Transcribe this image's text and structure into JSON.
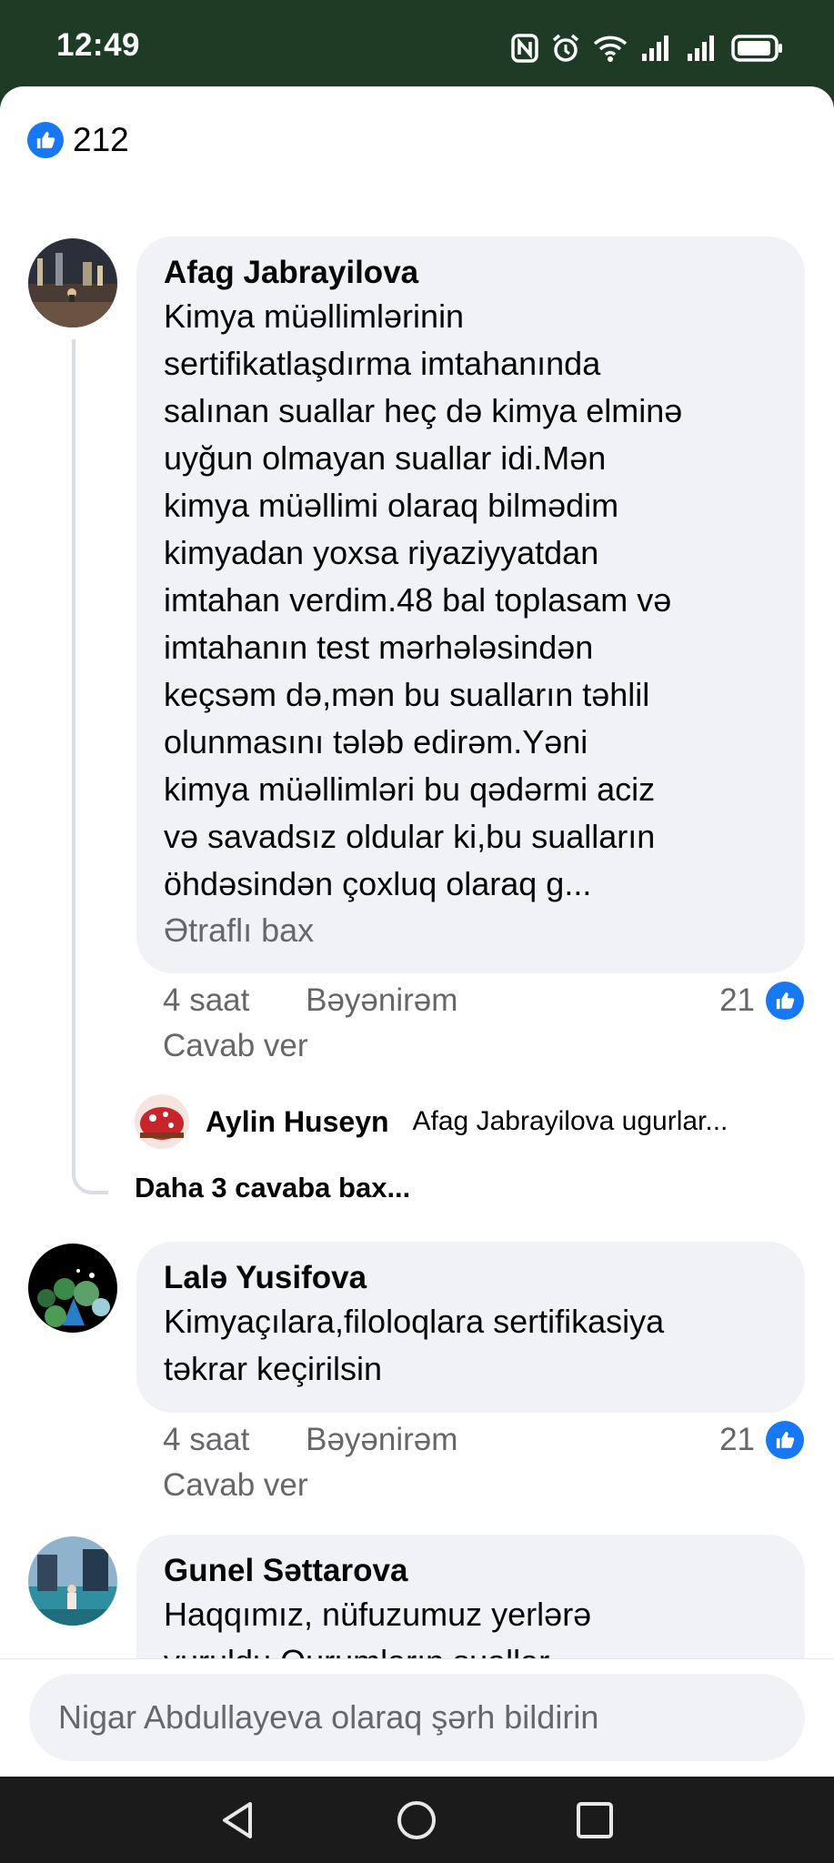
{
  "status_bar": {
    "time": "12:49"
  },
  "reactions": {
    "count": "212"
  },
  "comments": [
    {
      "author": "Afag Jabrayilova",
      "lines": [
        "Kimya müəllimlərinin",
        "sertifikatlaşdırma imtahanında",
        "salınan suallar heç də kimya elminə",
        "uyğun olmayan suallar idi.Mən",
        "kimya müəllimi olaraq bilmədim",
        "kimyadan yoxsa riyaziyyatdan",
        "imtahan verdim.48 bal toplasam və",
        "imtahanın test mərhələsindən",
        "keçsəm də,mən bu sualların təhlil",
        "olunmasını tələb edirəm.Yəni",
        "kimya müəllimləri bu qədərmi aciz",
        "və savadsız oldular ki,bu sualların",
        "öhdəsindən çoxluq olaraq g..."
      ],
      "see_more": "Ətraflı bax",
      "time": "4 saat",
      "like_label": "Bəyənirəm",
      "reply_label": "Cavab ver",
      "reaction_count": "21"
    },
    {
      "author": "Lalə Yusifova",
      "lines": [
        "Kimyaçılara,filoloqlara sertifikasiya",
        "təkrar keçirilsin"
      ],
      "time": "4 saat",
      "like_label": "Bəyənirəm",
      "reply_label": "Cavab ver",
      "reaction_count": "21"
    },
    {
      "author": "Gunel Səttarova",
      "lines": [
        "Haqqımız, nüfuzumuz yerlərə",
        "vuruldu.Qurumların suallar"
      ]
    }
  ],
  "reply_preview": {
    "author": "Aylin Huseyn",
    "text": "Afag Jabrayilova ugurlar..."
  },
  "more_replies": "Daha 3 cavaba bax...",
  "composer": {
    "placeholder": "Nigar Abdullayeva olaraq şərh bildirin"
  }
}
